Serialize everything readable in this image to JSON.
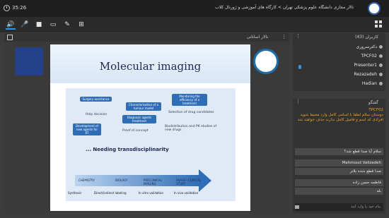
{
  "topbar": {
    "time": "35:26",
    "title": "تالار مجازی دانشگاه علوم پزشکی تهران > کارگاه های آموزشی و ژورنال کلاب"
  },
  "stage": {
    "title": "تالار اساتانی",
    "slide": {
      "title": "Molecular imaging",
      "boxes": [
        "Surgery assistance",
        "Characterisation of a tumour model",
        "Monitoring the efficiency of a treatment",
        "Development of new agents for RT",
        "Diagnosis agents treatment"
      ],
      "texts": [
        "Help decision",
        "Proof of concept",
        "Selection of drug candidates",
        "Biodistribution and PK studies of new drugs"
      ],
      "needing": "... Needing transdisciplinarity",
      "flow": [
        "CHEMISTRY",
        "BIOLOGY",
        "PRECLINICAL IMAGING",
        "PHASE I CLINICAL STUDY"
      ],
      "flow_sub": [
        "Synthesis",
        "Direct/indirect labeling",
        "In vitro validation",
        "In vivo validation"
      ]
    }
  },
  "users": {
    "title": "کاربران (43)",
    "items": [
      {
        "name": "دکترسروری"
      },
      {
        "name": "TPCF02"
      },
      {
        "name": "Presenter1"
      },
      {
        "name": "Rezazadeh"
      },
      {
        "name": "Hadian"
      }
    ]
  },
  "chat": {
    "title": "گفتگو",
    "orange_sender": "TPCF02",
    "orange_message": "دوستان سلام لطفا با اسامی کامل وارد محیط شوید افرادی که اسم و فامیل کامل ندارند حذف خواهند شد",
    "messages": [
      {
        "text": "سلام آیا صدا قطع شد؟"
      },
      {
        "text": "Mahmoud Valizadeh"
      },
      {
        "text": "صدا قطع شده بلاتر"
      },
      {
        "text": "فاطمه حسن زاده"
      },
      {
        "text": "بله"
      }
    ],
    "input_placeholder": "پیام خود را وارد کنید"
  }
}
